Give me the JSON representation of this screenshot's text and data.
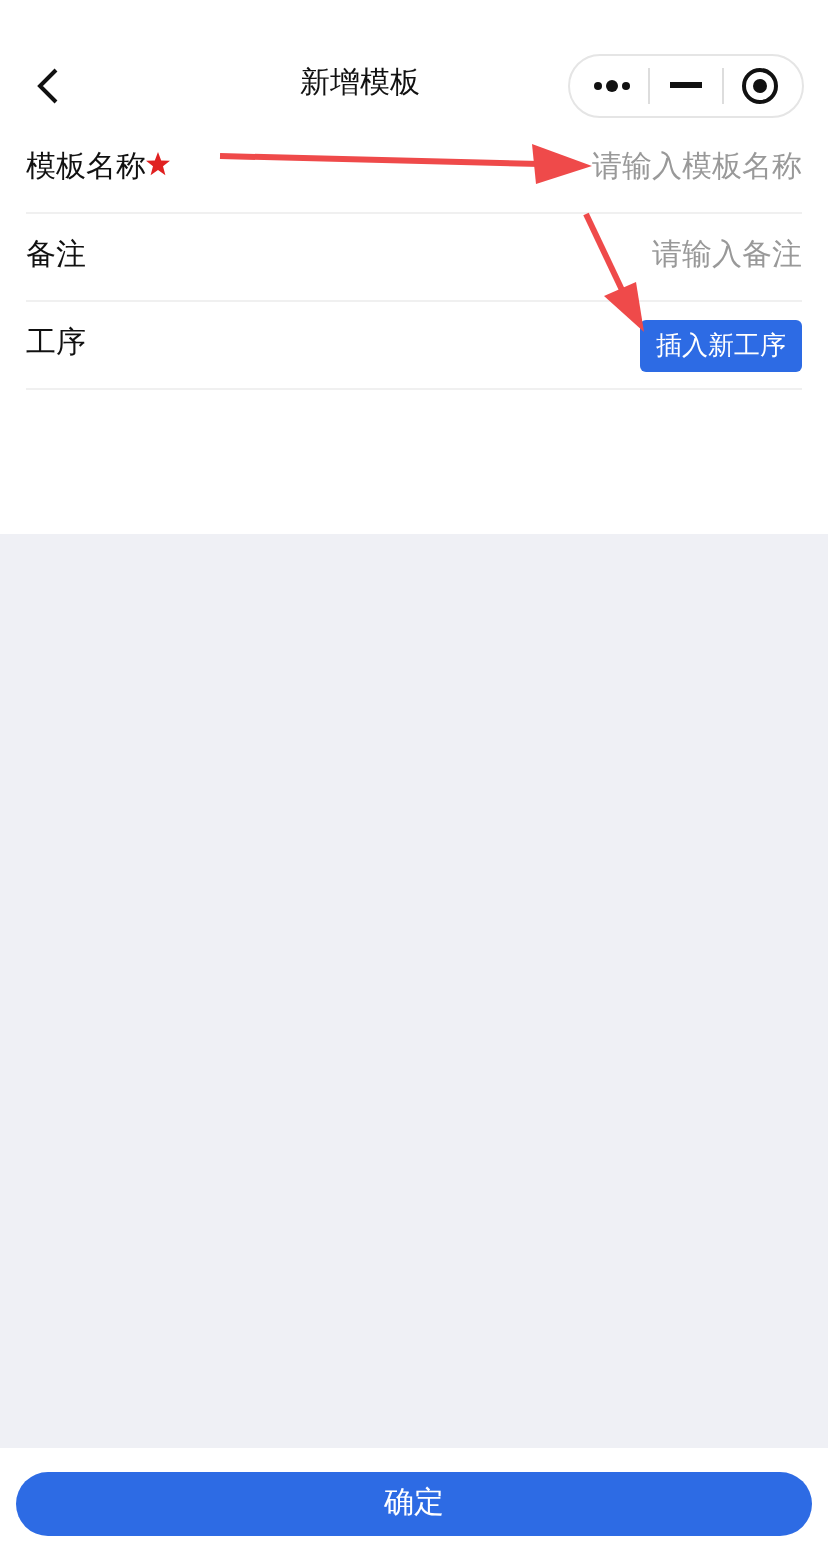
{
  "nav": {
    "title": "新增模板"
  },
  "fields": [
    {
      "label": "模板名称",
      "required": true,
      "kind": "input",
      "placeholder": "请输入模板名称"
    },
    {
      "label": "备注",
      "required": false,
      "kind": "input",
      "placeholder": "请输入备注"
    },
    {
      "label": "工序",
      "required": false,
      "kind": "button",
      "button": "插入新工序"
    }
  ],
  "confirm_button": "确定"
}
